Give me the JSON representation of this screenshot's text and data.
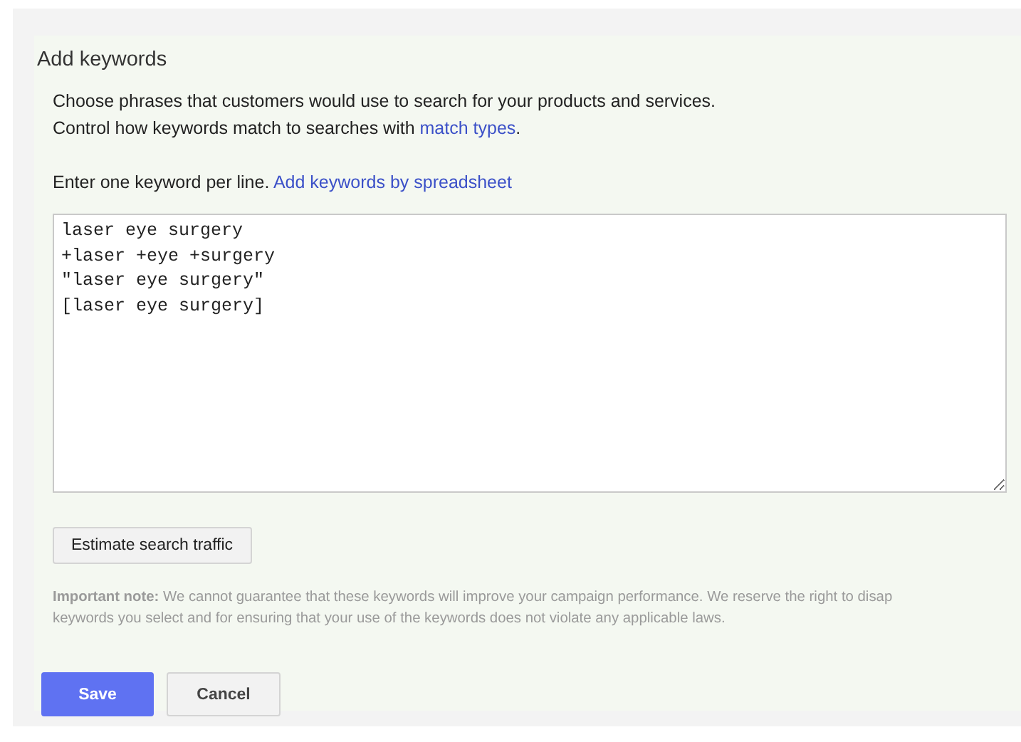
{
  "title": "Add keywords",
  "intro": [
    "Choose phrases that customers would use to search for your products and services.",
    "Control how keywords match to searches with"
  ],
  "match_types_link": "match types",
  "intro_end": ".",
  "enter_hint": "Enter one keyword per line.",
  "spreadsheet_link": "Add keywords by spreadsheet",
  "keywords": [
    "laser eye surgery",
    "+laser +eye +surgery",
    "\"laser eye surgery\"",
    "[laser eye surgery]"
  ],
  "estimate_button": "Estimate search traffic",
  "note_lines": [
    "**Important note:** We cannot guarantee that these keywords will improve your campaign performance. We reserve the right to disap",
    "keywords you select and for ensuring that your use of the keywords does not violate any applicable laws."
  ],
  "buttons": [
    {
      "label": "Save",
      "kind": "primary"
    },
    {
      "label": "Cancel",
      "kind": "secondary"
    }
  ]
}
